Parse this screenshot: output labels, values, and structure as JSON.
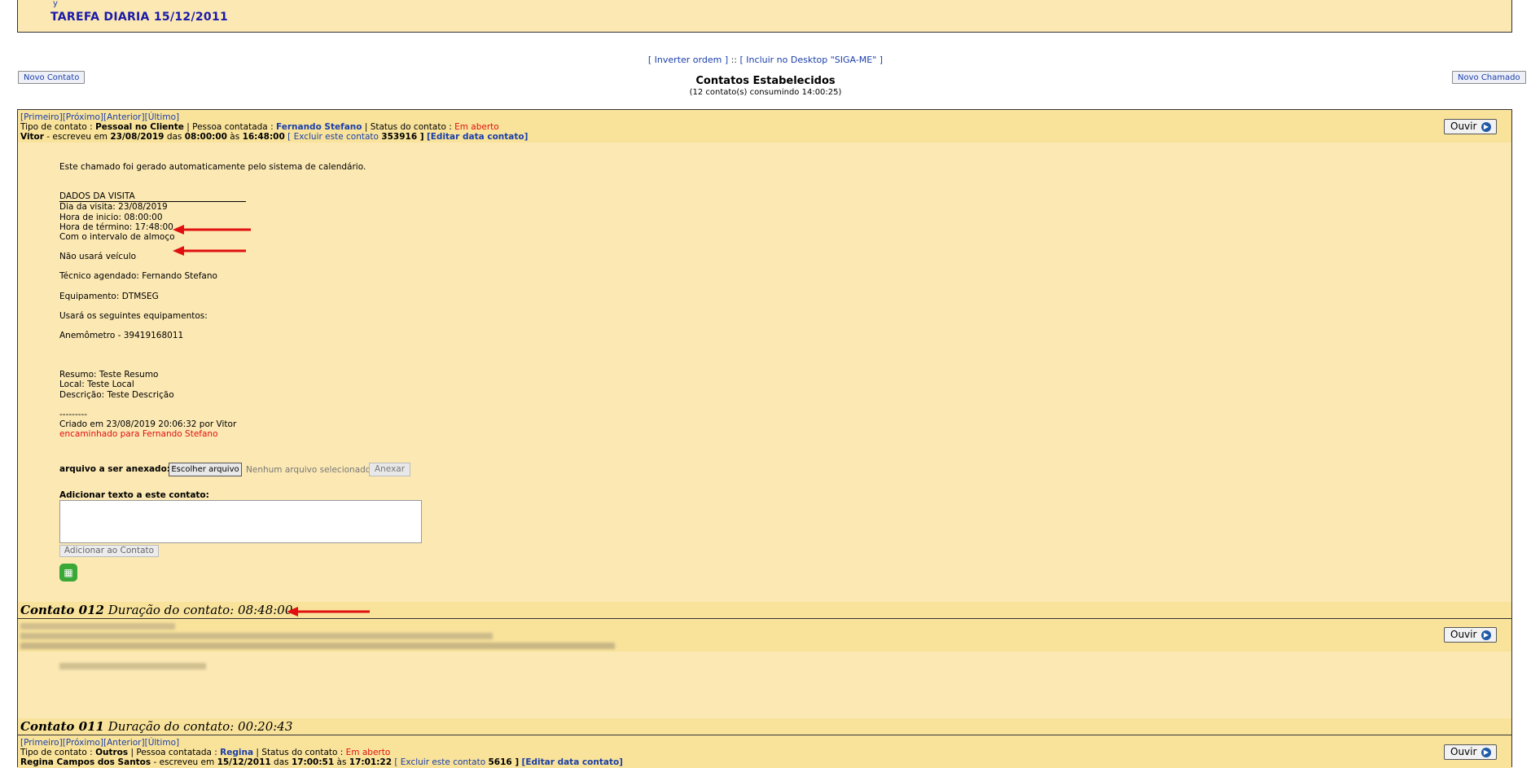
{
  "top": {
    "link_fragment": "y",
    "tarefa": "TAREFA DIARIA 15/12/2011"
  },
  "toolbar": {
    "invert_link": "[ Inverter ordem ]",
    "separator": " :: ",
    "desktop_link": "[ Incluir no Desktop \"SIGA-ME\" ]",
    "new_contact": "Novo Contato",
    "new_call": "Novo Chamado"
  },
  "summary": {
    "title": "Contatos Estabelecidos",
    "subtitle": "(12 contato(s) consumindo 14:00:25)"
  },
  "nav": {
    "first": "[Primeiro]",
    "next": "[Próximo]",
    "prev": "[Anterior]",
    "last": "[Último]"
  },
  "contact1": {
    "type_label": "Tipo de contato : ",
    "type_value": "Pessoal no Cliente",
    "person_label": " | Pessoa contatada : ",
    "person_value": "Fernando Stefano",
    "status_label": " | Status do contato : ",
    "status_value": "Em aberto",
    "author": "Vitor",
    "wrote_prefix": " - escreveu em ",
    "date": "23/08/2019",
    "das": " das ",
    "start": "08:00:00",
    "as": " às ",
    "end": "16:48:00",
    "delete_link": "[ Excluir este contato",
    "id": "353916",
    "id_close": " ]",
    "edit_link": "[Editar data contato]",
    "ouvir": "Ouvir",
    "body": {
      "l1": "Este chamado foi gerado automaticamente pelo sistema de calendário.",
      "l2": "DADOS DA VISITA",
      "l3": "Dia da visita: 23/08/2019",
      "l4": "Hora de inicio: 08:00:00",
      "l5": "Hora de término: 17:48:00",
      "l6": "Com o intervalo de almoço",
      "l7": "Não usará veículo",
      "l8": "Técnico agendado: Fernando Stefano",
      "l9": "Equipamento: DTMSEG",
      "l10": "Usará os seguintes equipamentos:",
      "l11": "Anemômetro - 39419168011",
      "l12": "Resumo: Teste Resumo",
      "l13": "Local: Teste Local",
      "l14": "Descrição: Teste Descrição",
      "l15": "---------",
      "l16": "Criado em 23/08/2019 20:06:32 por Vitor",
      "l17": "encaminhado para Fernando Stefano"
    },
    "attach_label": "arquivo a ser anexado:",
    "choose_file": "Escolher arquivo",
    "no_file": "Nenhum arquivo selecionado",
    "attach_button": "Anexar",
    "add_text_label": "Adicionar texto a este contato:",
    "add_button": "Adicionar ao Contato",
    "footer_bold": "Contato 012",
    "footer_rest": " Duração do contato: 08:48:00"
  },
  "contact2": {
    "ouvir": "Ouvir",
    "footer_bold": "Contato 011",
    "footer_rest": " Duração do contato: 00:20:43"
  },
  "contact3": {
    "type_label": "Tipo de contato : ",
    "type_value": "Outros",
    "person_label": " | Pessoa contatada : ",
    "person_value": "Regina",
    "status_label": " | Status do contato : ",
    "status_value": "Em aberto",
    "author": "Regina Campos dos Santos",
    "wrote_prefix": " - escreveu em ",
    "date": "15/12/2011",
    "das": " das ",
    "start": "17:00:51",
    "as": " às ",
    "end": "17:01:22",
    "delete_link": "[ Excluir este contato",
    "id": "5616",
    "id_close": " ]",
    "edit_link": "[Editar data contato]",
    "ouvir": "Ouvir"
  },
  "colors": {
    "background": "#fbe8b3",
    "header": "#f9e39b",
    "link": "#1a3ea8",
    "status": "#e01010",
    "arrow": "#e01010"
  }
}
